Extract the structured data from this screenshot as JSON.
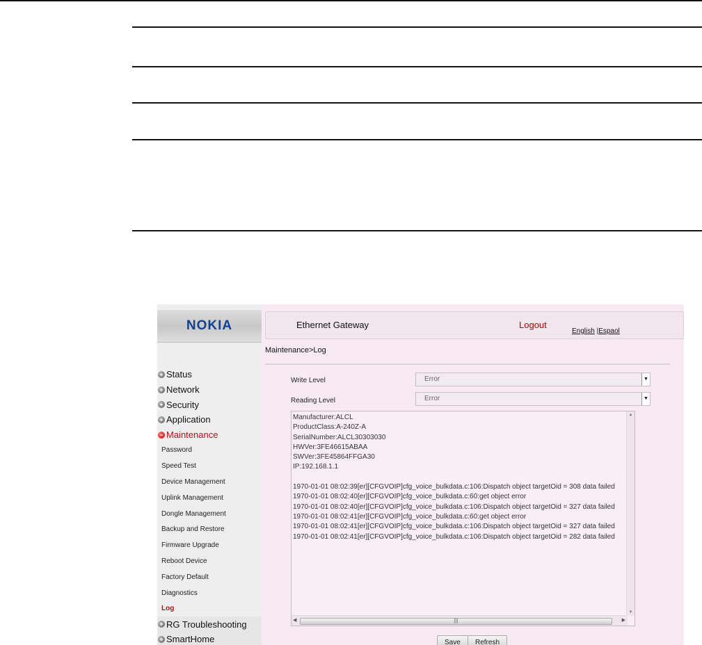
{
  "brand": "NOKIA",
  "header": {
    "title": "Ethernet Gateway",
    "logout": "Logout",
    "lang_en": "English",
    "lang_sep": " |",
    "lang_es": "Espaol"
  },
  "breadcrumb": "Maintenance>Log",
  "form": {
    "write_level_label": "Write Level",
    "write_level_value": "Error",
    "reading_level_label": "Reading Level",
    "reading_level_value": "Error"
  },
  "log_lines": [
    "Manufacturer:ALCL",
    "ProductClass:A-240Z-A",
    "SerialNumber:ALCL30303030",
    "HWVer:3FE46615ABAA",
    "SWVer:3FE45864FFGA30",
    "IP:192.168.1.1",
    "",
    "1970-01-01 08:02:39[er][CFGVOIP]cfg_voice_bulkdata.c:106:Dispatch object targetOid = 308 data failed",
    "1970-01-01 08:02:40[er][CFGVOIP]cfg_voice_bulkdata.c:60:get object error",
    "1970-01-01 08:02:40[er][CFGVOIP]cfg_voice_bulkdata.c:106:Dispatch object targetOid = 327 data failed",
    "1970-01-01 08:02:41[er][CFGVOIP]cfg_voice_bulkdata.c:60:get object error",
    "1970-01-01 08:02:41[er][CFGVOIP]cfg_voice_bulkdata.c:106:Dispatch object targetOid = 327 data failed",
    "1970-01-01 08:02:41[er][CFGVOIP]cfg_voice_bulkdata.c:106:Dispatch object targetOid = 282 data failed"
  ],
  "nav": {
    "status": "Status",
    "network": "Network",
    "security": "Security",
    "application": "Application",
    "maintenance": "Maintenance",
    "sub": [
      "Password",
      "Speed Test",
      "Device Management",
      "Uplink Management",
      "Dongle Management",
      "Backup and Restore",
      "Firmware Upgrade",
      "Reboot Device",
      "Factory Default",
      "Diagnostics",
      "Log"
    ],
    "rg_troubleshooting": "RG Troubleshooting",
    "smarthome": "SmartHome"
  },
  "buttons": {
    "save": "Save",
    "refresh": "Refresh"
  },
  "colors": {
    "accent_red": "#b1101a",
    "brand_blue": "#124191",
    "panel_bg": "#f7eaf3"
  }
}
